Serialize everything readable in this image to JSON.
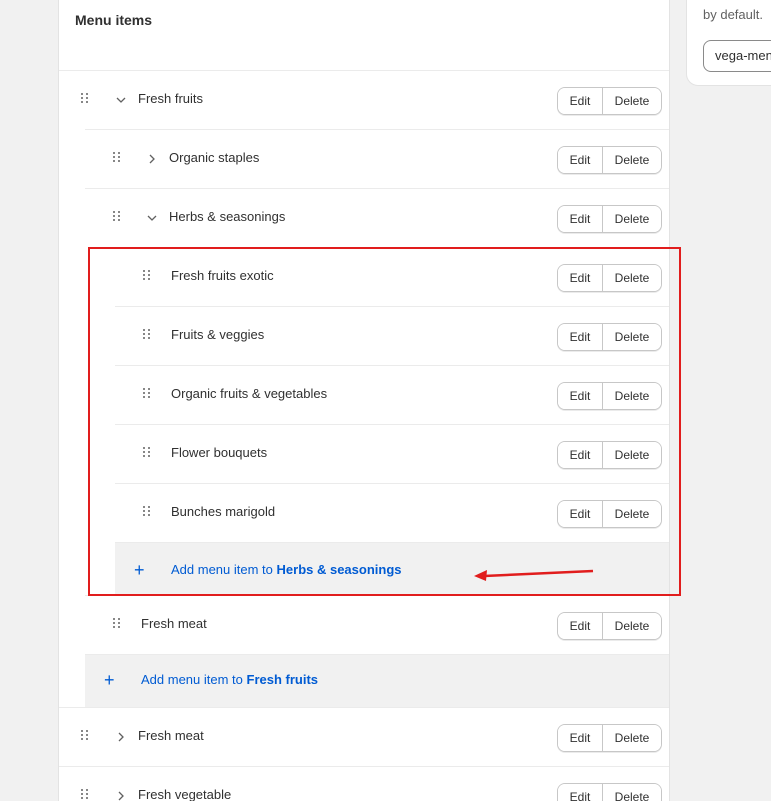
{
  "side_panel": {
    "text": "by default.",
    "input_value": "vega-menu"
  },
  "menu": {
    "title": "Menu items",
    "edit_label": "Edit",
    "delete_label": "Delete",
    "add_prefix": "Add menu item to",
    "items": [
      {
        "label": "Fresh fruits",
        "level": 0,
        "chevron": "chevron-down"
      },
      {
        "label": "Organic staples",
        "level": 1,
        "chevron": "chevron-right"
      },
      {
        "label": "Herbs & seasonings",
        "level": 1,
        "chevron": "chevron-down"
      },
      {
        "label": "Fresh fruits exotic",
        "level": 2
      },
      {
        "label": "Fruits & veggies",
        "level": 2
      },
      {
        "label": "Organic fruits & vegetables",
        "level": 2
      },
      {
        "label": "Flower bouquets",
        "level": 2
      },
      {
        "label": "Bunches marigold",
        "level": 2
      },
      {
        "label": "Fresh meat",
        "level": 1
      },
      {
        "label": "Fresh meat",
        "level": 0,
        "chevron": "chevron-right"
      },
      {
        "label": "Fresh vegetable",
        "level": 0,
        "chevron": "chevron-right"
      }
    ],
    "add_herbs_target": "Herbs & seasonings",
    "add_fruits_target": "Fresh fruits"
  },
  "colors": {
    "link": "#005bd3",
    "highlight": "#e11d1d"
  }
}
